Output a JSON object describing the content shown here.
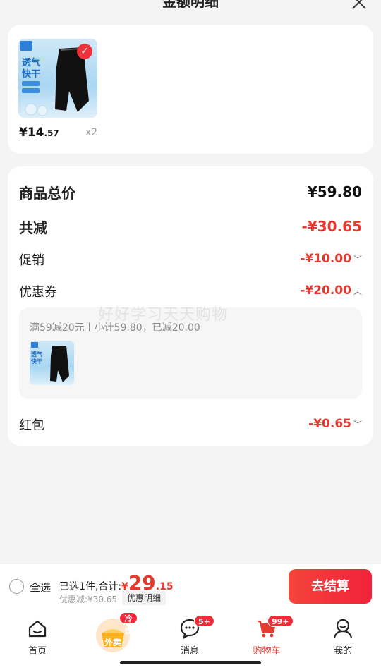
{
  "header": {
    "title": "金额明细"
  },
  "product": {
    "price_int": "¥14",
    "price_dec": ".57",
    "quantity": "x2",
    "thumb_text_1": "透气",
    "thumb_text_2": "快干"
  },
  "summary": {
    "total_label": "商品总价",
    "total_value": "¥59.80",
    "reduce_label": "共减",
    "reduce_value": "-¥30.65",
    "promo_label": "促销",
    "promo_value": "-¥10.00",
    "coupon_label": "优惠券",
    "coupon_value": "-¥20.00",
    "coupon_detail": "满59减20元丨小计59.80，已减20.00",
    "redpack_label": "红包",
    "redpack_value": "-¥0.65",
    "watermark": "好好学习天天购物"
  },
  "checkout": {
    "select_all": "全选",
    "selected_prefix": "已选1件,合计:",
    "currency": "¥",
    "total_int": "29",
    "total_dec": ".15",
    "discount_text": "优惠减:¥30.65",
    "detail_button": "优惠明细",
    "checkout_button": "去结算"
  },
  "tabs": [
    {
      "label": "首页"
    },
    {
      "label": "外卖",
      "badge": "冷饮"
    },
    {
      "label": "消息",
      "badge": "5+"
    },
    {
      "label": "购物车",
      "badge": "99+"
    },
    {
      "label": "我的"
    }
  ],
  "colors": {
    "accent": "#e63a2e",
    "badge": "#f02b3a"
  }
}
